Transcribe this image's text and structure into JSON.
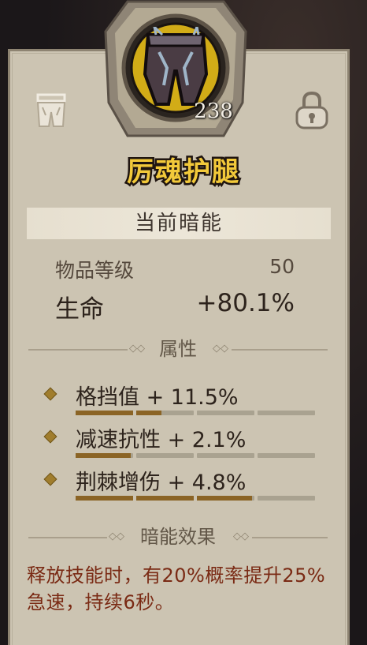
{
  "item": {
    "name": "厉魂护腿",
    "level_badge": "238",
    "icon": "leg-armor-icon",
    "left_icon": "armor-slot-icon",
    "right_icon": "lock-icon"
  },
  "section": {
    "title": "当前暗能"
  },
  "stats": {
    "item_level_label": "物品等级",
    "item_level_value": "50",
    "life_label": "生命",
    "life_value": "+80.1%"
  },
  "attributes": {
    "header": "属性",
    "items": [
      {
        "label": "格挡值 + 11.5%",
        "fill": 0.36
      },
      {
        "label": "减速抗性 + 2.1%",
        "fill": 0.24
      },
      {
        "label": "荆棘增伤 + 4.8%",
        "fill": 0.74
      }
    ]
  },
  "effect": {
    "header": "暗能效果",
    "text": "释放技能时，有20%概率提升25%急速，持续6秒。"
  },
  "colors": {
    "name": "#f2c93a",
    "effect_text": "#7a2a14",
    "bar_fill": "#8b6425",
    "panel": "#ccc4b2"
  }
}
